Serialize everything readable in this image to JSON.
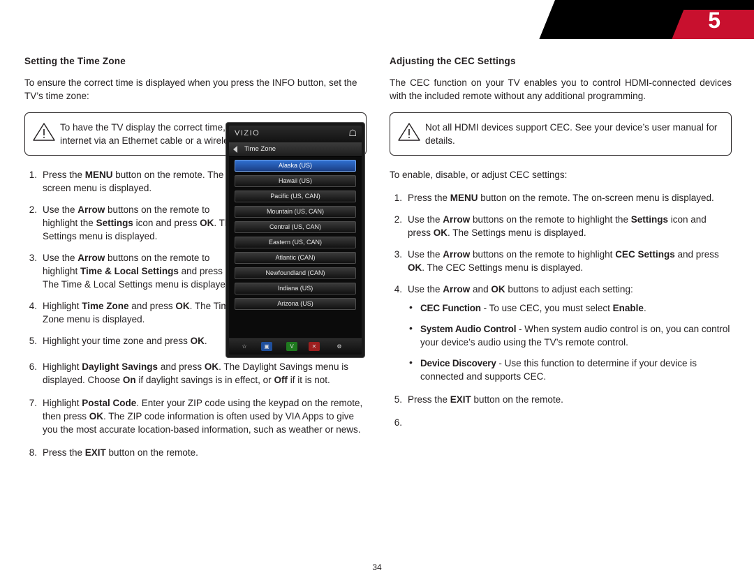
{
  "header": {
    "chapter_number": "5"
  },
  "left": {
    "title": "Setting the Time Zone",
    "intro": "To ensure the correct time is displayed when you press the INFO button, set the TV’s time zone:",
    "note": {
      "icon": "warning-icon",
      "text": "To have the TV display the correct time, you must be connected to the internet via an Ethernet cable or a wireless network."
    },
    "steps": [
      {
        "num": "1.",
        "html": "Press the <b>MENU</b> button on the remote. The on-screen menu is displayed."
      },
      {
        "num": "2.",
        "html": "Use the <b>Arrow</b> buttons on the remote to highlight the <b>Settings</b> icon and press <b>OK</b>. The Settings menu is displayed."
      },
      {
        "num": "3.",
        "html": "Use the <b>Arrow</b> buttons on the remote to highlight <b>Time &amp; Local Settings</b> and press <b>OK</b>. The Time &amp; Local Settings menu is displayed."
      },
      {
        "num": "4.",
        "html": "Highlight <b>Time Zone</b> and press <b>OK</b>. The Time Zone menu is displayed."
      },
      {
        "num": "5.",
        "html": "Highlight your time zone and press <b>OK</b>."
      },
      {
        "num": "6.",
        "html": "Highlight <b>Daylight Savings</b> and press <b>OK</b>. The Daylight Savings menu is displayed. Choose <b>On</b> if daylight savings is in effect, or <b>Off</b> if it is not."
      },
      {
        "num": "7.",
        "html": "Highlight <b>Postal Code</b>. Enter your ZIP code using the keypad on the remote, then press <b>OK</b>. The ZIP code information is often used by VIA Apps to give you the most accurate location-based information, such as weather or news."
      },
      {
        "num": "8.",
        "html": "Press the <b>EXIT</b> button on the remote."
      }
    ]
  },
  "tv_screen": {
    "brand": "VIZIO",
    "home_icon": "home-icon",
    "back_icon": "back-arrow-icon",
    "menu_title": "Time Zone",
    "menu_items": [
      "Alaska (US)",
      "Hawaii (US)",
      "Pacific (US, CAN)",
      "Mountain (US, CAN)",
      "Central (US, CAN)",
      "Eastern (US, CAN)",
      "Atlantic (CAN)",
      "Newfoundland (CAN)",
      "Indiana (US)",
      "Arizona (US)"
    ],
    "selected_index": 0,
    "bottom_icons": [
      "star-icon",
      "tv-icon",
      "v-badge-icon",
      "close-icon",
      "gear-icon"
    ]
  },
  "right": {
    "title": "Adjusting the CEC Settings",
    "intro": "The CEC function on your TV enables you to control HDMI-connected devices with the included remote without any additional programming.",
    "note": {
      "icon": "warning-icon",
      "text": "Not all HDMI devices support CEC. See your device’s user manual for details."
    },
    "lead": "To enable, disable, or adjust CEC settings:",
    "steps": [
      {
        "num": "1.",
        "html": "Press the <b>MENU</b> button on the remote. The on-screen menu is displayed."
      },
      {
        "num": "2.",
        "html": "Use the <b>Arrow</b> buttons on the remote to highlight the <b>Settings</b> icon and press <b>OK</b>. The Settings menu is displayed."
      },
      {
        "num": "3.",
        "html": "Use the <b>Arrow</b> buttons on the remote to highlight <b>CEC Settings</b> and press <b>OK</b>. The CEC Settings menu is displayed."
      },
      {
        "num": "4.",
        "html": "Use the <b>Arrow</b> and <b>OK</b> buttons to adjust each setting:"
      },
      {
        "num": "5.",
        "html": "Press the <b>EXIT</b> button on the remote."
      },
      {
        "num": "6.",
        "html": ""
      }
    ],
    "bullets": [
      {
        "html": "<span class=\"cond\">CEC Function</span> - To use CEC, you must select <b>Enable</b>."
      },
      {
        "html": "<span class=\"cond\">System Audio Control</span> - When system audio control is on, you can control your device’s audio using the TV’s remote control."
      },
      {
        "html": "<span class=\"cond\">Device Discovery</span> - Use this function to determine if your device is connected and supports CEC."
      }
    ]
  },
  "footer": {
    "page_number": "34"
  },
  "colors": {
    "accent_red": "#c8102e",
    "text": "#231f20",
    "menu_highlight": "#2f6fd0"
  }
}
